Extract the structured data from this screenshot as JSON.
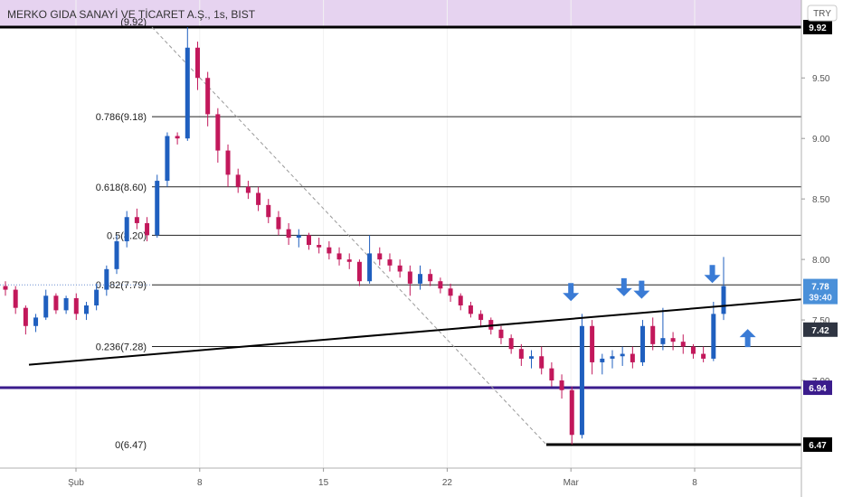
{
  "header": {
    "title": "MERKO GIDA SANAYİ VE TİCARET A.Ş., 1s, BIST",
    "currency": "TRY",
    "band_color": "#e6d3f0"
  },
  "chart_data": {
    "type": "candlestick",
    "ylim": [
      6.35,
      9.95
    ],
    "x_ticks": [
      {
        "label": "Şub",
        "date": "2023-02-01"
      },
      {
        "label": "8",
        "date": "2023-02-08"
      },
      {
        "label": "15",
        "date": "2023-02-15"
      },
      {
        "label": "22",
        "date": "2023-02-22"
      },
      {
        "label": "Mar",
        "date": "2023-03-01"
      },
      {
        "label": "8",
        "date": "2023-03-08"
      }
    ],
    "y_ticks": [
      "9.50",
      "9.00",
      "8.50",
      "8.00",
      "7.50",
      "7.00"
    ],
    "fib_levels": [
      {
        "label": "(9.92)",
        "ratio": 1,
        "value": 9.92
      },
      {
        "label": "0.786(9.18)",
        "ratio": 0.786,
        "value": 9.18
      },
      {
        "label": "0.618(8.60)",
        "ratio": 0.618,
        "value": 8.6
      },
      {
        "label": "0.5(8.20)",
        "ratio": 0.5,
        "value": 8.2
      },
      {
        "label": "0.382(7.79)",
        "ratio": 0.382,
        "value": 7.79
      },
      {
        "label": "0.236(7.28)",
        "ratio": 0.236,
        "value": 7.28
      },
      {
        "label": "0(6.47)",
        "ratio": 0,
        "value": 6.47
      }
    ],
    "horizontal_lines": [
      {
        "value": 9.92,
        "color": "#000000",
        "label": "9.92"
      },
      {
        "value": 6.94,
        "color": "#3b1c8c",
        "label": "6.94"
      },
      {
        "value": 6.47,
        "color": "#000000",
        "label": "6.47"
      }
    ],
    "trendline": {
      "from": {
        "date": "2023-02-01",
        "value": 7.13
      },
      "to": {
        "date": "2023-03-13",
        "value": 7.67
      }
    },
    "price_labels": [
      {
        "text": "7.78",
        "value": 7.78,
        "color": "#4a90d9"
      },
      {
        "text": "39:40",
        "value": 7.69,
        "color": "#4a90d9"
      },
      {
        "text": "7.42",
        "value": 7.42,
        "color": "#2f3542"
      }
    ],
    "arrows": [
      {
        "direction": "down",
        "date": "2023-02-29",
        "value": 7.7
      },
      {
        "direction": "down",
        "date": "2023-03-04",
        "value": 7.74
      },
      {
        "direction": "down",
        "date": "2023-03-05",
        "value": 7.72
      },
      {
        "direction": "down",
        "date": "2023-03-09",
        "value": 7.85
      },
      {
        "direction": "up",
        "date": "2023-03-11",
        "value": 7.38
      }
    ],
    "series": [
      {
        "values": [
          [
            7.78,
            7.82,
            7.7,
            7.75
          ],
          [
            7.75,
            7.78,
            7.55,
            7.6
          ],
          [
            7.6,
            7.62,
            7.38,
            7.45
          ],
          [
            7.45,
            7.55,
            7.4,
            7.52
          ],
          [
            7.52,
            7.75,
            7.5,
            7.7
          ],
          [
            7.7,
            7.72,
            7.55,
            7.58
          ],
          [
            7.58,
            7.7,
            7.55,
            7.68
          ],
          [
            7.68,
            7.72,
            7.5,
            7.55
          ],
          [
            7.55,
            7.65,
            7.5,
            7.62
          ],
          [
            7.62,
            7.8,
            7.58,
            7.75
          ],
          [
            7.75,
            7.95,
            7.7,
            7.92
          ],
          [
            7.92,
            8.2,
            7.88,
            8.15
          ],
          [
            8.15,
            8.4,
            8.1,
            8.35
          ],
          [
            8.35,
            8.42,
            8.25,
            8.3
          ],
          [
            8.3,
            8.35,
            8.15,
            8.2
          ],
          [
            8.2,
            8.7,
            8.18,
            8.65
          ],
          [
            8.65,
            9.05,
            8.6,
            9.02
          ],
          [
            9.02,
            9.05,
            8.95,
            9.0
          ],
          [
            9.0,
            9.92,
            8.98,
            9.75
          ],
          [
            9.75,
            9.8,
            9.4,
            9.5
          ],
          [
            9.5,
            9.55,
            9.1,
            9.2
          ],
          [
            9.2,
            9.25,
            8.8,
            8.9
          ],
          [
            8.9,
            8.95,
            8.6,
            8.7
          ],
          [
            8.7,
            8.75,
            8.55,
            8.6
          ],
          [
            8.6,
            8.65,
            8.5,
            8.55
          ],
          [
            8.55,
            8.6,
            8.4,
            8.45
          ],
          [
            8.45,
            8.5,
            8.3,
            8.35
          ],
          [
            8.35,
            8.4,
            8.2,
            8.25
          ],
          [
            8.25,
            8.3,
            8.12,
            8.18
          ],
          [
            8.18,
            8.25,
            8.1,
            8.2
          ],
          [
            8.2,
            8.22,
            8.08,
            8.12
          ],
          [
            8.12,
            8.18,
            8.05,
            8.1
          ],
          [
            8.1,
            8.15,
            8.0,
            8.05
          ],
          [
            8.05,
            8.1,
            7.95,
            8.0
          ],
          [
            8.0,
            8.05,
            7.92,
            7.98
          ],
          [
            7.98,
            8.0,
            7.78,
            7.82
          ],
          [
            7.82,
            8.2,
            7.8,
            8.05
          ],
          [
            8.05,
            8.1,
            7.95,
            8.0
          ],
          [
            8.0,
            8.05,
            7.9,
            7.95
          ],
          [
            7.95,
            8.0,
            7.85,
            7.9
          ],
          [
            7.9,
            7.95,
            7.7,
            7.8
          ],
          [
            7.8,
            7.95,
            7.75,
            7.88
          ],
          [
            7.88,
            7.92,
            7.78,
            7.82
          ],
          [
            7.82,
            7.85,
            7.72,
            7.76
          ],
          [
            7.76,
            7.8,
            7.65,
            7.7
          ],
          [
            7.7,
            7.72,
            7.58,
            7.62
          ],
          [
            7.62,
            7.65,
            7.52,
            7.55
          ],
          [
            7.55,
            7.58,
            7.45,
            7.5
          ],
          [
            7.5,
            7.52,
            7.38,
            7.42
          ],
          [
            7.42,
            7.45,
            7.3,
            7.35
          ],
          [
            7.35,
            7.38,
            7.22,
            7.26
          ],
          [
            7.26,
            7.3,
            7.12,
            7.18
          ],
          [
            7.18,
            7.25,
            7.1,
            7.2
          ],
          [
            7.2,
            7.28,
            7.05,
            7.1
          ],
          [
            7.1,
            7.15,
            6.95,
            7.0
          ],
          [
            7.0,
            7.05,
            6.85,
            6.92
          ],
          [
            6.92,
            6.95,
            6.47,
            6.55
          ],
          [
            6.55,
            7.55,
            6.52,
            7.45
          ],
          [
            7.45,
            7.5,
            7.05,
            7.15
          ],
          [
            7.15,
            7.22,
            7.05,
            7.18
          ],
          [
            7.18,
            7.25,
            7.1,
            7.2
          ],
          [
            7.2,
            7.28,
            7.12,
            7.22
          ],
          [
            7.22,
            7.28,
            7.1,
            7.15
          ],
          [
            7.15,
            7.5,
            7.12,
            7.45
          ],
          [
            7.45,
            7.52,
            7.25,
            7.3
          ],
          [
            7.3,
            7.6,
            7.25,
            7.35
          ],
          [
            7.35,
            7.4,
            7.25,
            7.32
          ],
          [
            7.32,
            7.38,
            7.22,
            7.28
          ],
          [
            7.28,
            7.3,
            7.18,
            7.22
          ],
          [
            7.22,
            7.28,
            7.15,
            7.18
          ],
          [
            7.18,
            7.65,
            7.16,
            7.55
          ],
          [
            7.55,
            8.02,
            7.5,
            7.78
          ]
        ]
      }
    ]
  }
}
